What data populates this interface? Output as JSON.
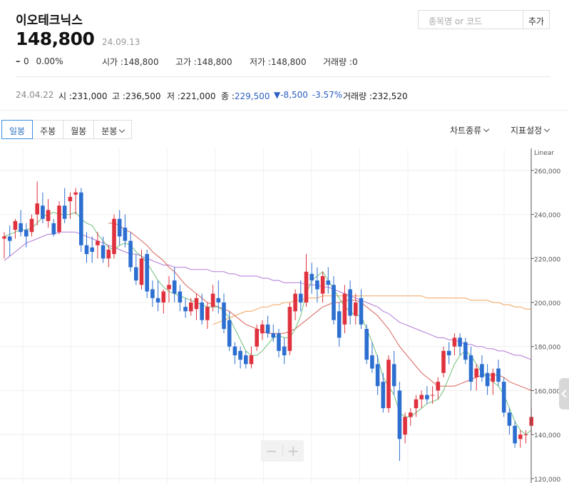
{
  "header": {
    "stock_name": "이오테크닉스",
    "price": "148,800",
    "date": "24.09.13",
    "change_dash": "–",
    "change": "0",
    "change_pct": "0.00%",
    "open_label": "시가 :",
    "open_value": "148,800",
    "high_label": "고가 :",
    "high_value": "148,800",
    "low_label": "저가 :",
    "low_value": "148,800",
    "volume_label": "거래량 :",
    "volume_value": "0",
    "search_placeholder": "종목명 or 코드",
    "add_label": "추가"
  },
  "hover": {
    "date": "24.04.22",
    "open_label": "시 :",
    "open_value": "231,000",
    "high_label": "고 :",
    "high_value": "236,500",
    "low_label": "저 :",
    "low_value": "221,000",
    "close_label": "종 :",
    "close_value": "229,500",
    "change_value": "▼-8,500",
    "change_pct": "-3.57%",
    "volume_label": "거래량 :",
    "volume_value": "232,520"
  },
  "tabs": [
    {
      "label": "일봉",
      "active": true
    },
    {
      "label": "주봉",
      "active": false
    },
    {
      "label": "월봉",
      "active": false
    },
    {
      "label": "분봉",
      "active": false,
      "dropdown": true
    }
  ],
  "menus": {
    "chart_type": "차트종류",
    "indicator": "지표설정"
  },
  "zoom": {
    "minus": "−",
    "plus": "+"
  },
  "colors": {
    "up": "#e0323e",
    "down": "#2c6fd1",
    "ma5": "#6dc07a",
    "ma20": "#d9665e",
    "ma60": "#b27ad8",
    "ma120": "#f0a35a"
  },
  "chart_data": {
    "type": "candlestick",
    "scale_label": "Linear",
    "y_ticks": [
      120000,
      140000,
      160000,
      180000,
      200000,
      220000,
      240000,
      260000
    ],
    "y_tick_labels": [
      "120,000",
      "140,000",
      "160,000",
      "180,000",
      "200,000",
      "220,000",
      "240,000",
      "260,000"
    ],
    "ylim": [
      118000,
      270000
    ],
    "grid": true,
    "candles": [
      [
        229,
        232,
        220,
        230
      ],
      [
        230,
        235,
        221,
        228
      ],
      [
        233,
        238,
        229,
        237
      ],
      [
        236,
        242,
        230,
        232
      ],
      [
        233,
        236,
        225,
        230
      ],
      [
        232,
        240,
        230,
        238
      ],
      [
        240,
        255,
        235,
        245
      ],
      [
        244,
        250,
        236,
        238
      ],
      [
        237,
        247,
        234,
        242
      ],
      [
        236,
        238,
        230,
        231
      ],
      [
        232,
        246,
        231,
        244
      ],
      [
        244,
        252,
        236,
        238
      ],
      [
        246,
        250,
        238,
        248
      ],
      [
        249,
        252,
        240,
        250
      ],
      [
        250,
        252,
        223,
        226
      ],
      [
        226,
        232,
        218,
        222
      ],
      [
        225,
        230,
        218,
        223
      ],
      [
        226,
        232,
        220,
        228
      ],
      [
        226,
        230,
        218,
        220
      ],
      [
        220,
        226,
        216,
        224
      ],
      [
        222,
        240,
        220,
        238
      ],
      [
        238,
        242,
        226,
        230
      ],
      [
        234,
        240,
        225,
        228
      ],
      [
        228,
        232,
        214,
        216
      ],
      [
        216,
        222,
        208,
        210
      ],
      [
        208,
        224,
        206,
        220
      ],
      [
        222,
        224,
        202,
        205
      ],
      [
        206,
        210,
        198,
        202
      ],
      [
        202,
        210,
        196,
        200
      ],
      [
        200,
        206,
        195,
        205
      ],
      [
        206,
        212,
        200,
        208
      ],
      [
        210,
        216,
        200,
        204
      ],
      [
        205,
        208,
        196,
        200
      ],
      [
        198,
        202,
        193,
        196
      ],
      [
        196,
        202,
        194,
        200
      ],
      [
        197,
        204,
        192,
        202
      ],
      [
        200,
        204,
        190,
        192
      ],
      [
        192,
        200,
        188,
        198
      ],
      [
        198,
        208,
        196,
        204
      ],
      [
        202,
        210,
        195,
        200
      ],
      [
        200,
        204,
        186,
        188
      ],
      [
        192,
        196,
        178,
        180
      ],
      [
        180,
        182,
        172,
        176
      ],
      [
        178,
        180,
        170,
        174
      ],
      [
        176,
        178,
        170,
        172
      ],
      [
        172,
        180,
        170,
        176
      ],
      [
        180,
        190,
        178,
        188
      ],
      [
        186,
        192,
        183,
        190
      ],
      [
        190,
        194,
        184,
        186
      ],
      [
        186,
        190,
        182,
        184
      ],
      [
        186,
        188,
        175,
        178
      ],
      [
        180,
        184,
        172,
        176
      ],
      [
        178,
        200,
        176,
        198
      ],
      [
        196,
        206,
        192,
        204
      ],
      [
        204,
        210,
        196,
        200
      ],
      [
        200,
        222,
        198,
        214
      ],
      [
        213,
        218,
        204,
        210
      ],
      [
        210,
        216,
        200,
        206
      ],
      [
        204,
        214,
        200,
        212
      ],
      [
        210,
        216,
        204,
        208
      ],
      [
        208,
        212,
        190,
        192
      ],
      [
        196,
        200,
        180,
        184
      ],
      [
        190,
        208,
        186,
        204
      ],
      [
        206,
        210,
        190,
        194
      ],
      [
        194,
        204,
        190,
        200
      ],
      [
        202,
        206,
        188,
        190
      ],
      [
        188,
        190,
        172,
        174
      ],
      [
        176,
        182,
        168,
        170
      ],
      [
        172,
        176,
        158,
        162
      ],
      [
        164,
        168,
        150,
        152
      ],
      [
        152,
        176,
        150,
        174
      ],
      [
        172,
        178,
        158,
        162
      ],
      [
        160,
        164,
        128,
        138
      ],
      [
        140,
        150,
        136,
        148
      ],
      [
        148,
        152,
        144,
        150
      ],
      [
        152,
        158,
        148,
        156
      ],
      [
        156,
        160,
        152,
        158
      ],
      [
        158,
        162,
        154,
        156
      ],
      [
        158,
        162,
        154,
        158
      ],
      [
        160,
        166,
        156,
        164
      ],
      [
        168,
        180,
        166,
        178
      ],
      [
        178,
        182,
        172,
        176
      ],
      [
        180,
        186,
        176,
        184
      ],
      [
        184,
        186,
        176,
        180
      ],
      [
        182,
        184,
        172,
        174
      ],
      [
        176,
        180,
        160,
        164
      ],
      [
        166,
        172,
        160,
        170
      ],
      [
        172,
        176,
        164,
        166
      ],
      [
        168,
        172,
        158,
        162
      ],
      [
        164,
        170,
        158,
        168
      ],
      [
        170,
        174,
        162,
        164
      ],
      [
        164,
        166,
        148,
        150
      ],
      [
        150,
        152,
        140,
        144
      ],
      [
        144,
        146,
        134,
        136
      ],
      [
        138,
        142,
        134,
        140
      ],
      [
        140,
        142,
        136,
        140
      ],
      [
        144,
        152,
        140,
        148
      ]
    ],
    "ma5": [
      230,
      231,
      232,
      233,
      233,
      234,
      236,
      239,
      240,
      241,
      240,
      240,
      240,
      241,
      238,
      236,
      235,
      231,
      228,
      225,
      224,
      226,
      227,
      226,
      223,
      221,
      218,
      214,
      210,
      207,
      205,
      204,
      203,
      202,
      201,
      200,
      199,
      198,
      198,
      198,
      196,
      193,
      188,
      183,
      178,
      176,
      176,
      178,
      181,
      184,
      185,
      184,
      184,
      188,
      194,
      204,
      210,
      212,
      214,
      210,
      206,
      202,
      198,
      196,
      194,
      194,
      188,
      182,
      175,
      166,
      162,
      158,
      150,
      148,
      148,
      150,
      152,
      154,
      155,
      156,
      160,
      166,
      172,
      176,
      178,
      176,
      172,
      168,
      166,
      164,
      162,
      158,
      152,
      146,
      142,
      140,
      142
    ],
    "ma20": [
      null,
      null,
      null,
      null,
      null,
      null,
      null,
      null,
      null,
      null,
      null,
      null,
      null,
      null,
      null,
      null,
      null,
      null,
      null,
      236,
      236,
      235,
      233,
      232,
      230,
      228,
      226,
      223,
      221,
      219,
      216,
      214,
      211,
      208,
      206,
      204,
      202,
      200,
      199,
      198,
      197,
      196,
      194,
      192,
      190,
      189,
      188,
      187,
      186,
      186,
      186,
      186,
      187,
      188,
      190,
      192,
      194,
      196,
      198,
      199,
      200,
      200,
      201,
      201,
      201,
      200,
      198,
      196,
      194,
      191,
      188,
      184,
      180,
      177,
      174,
      171,
      168,
      166,
      164,
      162,
      162,
      162,
      162,
      163,
      164,
      165,
      166,
      167,
      167,
      167,
      167,
      166,
      164,
      163,
      162,
      161,
      160
    ],
    "ma60": [
      219,
      221,
      223,
      225,
      227,
      228,
      229,
      230,
      231,
      231,
      232,
      232,
      232,
      232,
      231,
      230,
      229,
      228,
      227,
      226,
      225,
      224,
      223,
      222,
      222,
      221,
      220,
      219,
      218,
      217,
      217,
      216,
      216,
      216,
      215,
      215,
      215,
      215,
      214,
      214,
      214,
      213,
      213,
      212,
      212,
      212,
      212,
      211,
      211,
      210,
      210,
      209,
      209,
      209,
      209,
      208,
      208,
      208,
      207,
      207,
      206,
      205,
      204,
      203,
      202,
      201,
      200,
      199,
      198,
      196,
      195,
      193,
      191,
      190,
      189,
      188,
      187,
      186,
      185,
      184,
      184,
      183,
      183,
      182,
      181,
      181,
      180,
      180,
      179,
      179,
      178,
      178,
      177,
      176,
      176,
      175,
      174
    ],
    "ma120": [
      null,
      null,
      null,
      null,
      null,
      null,
      null,
      null,
      null,
      null,
      null,
      null,
      null,
      null,
      null,
      null,
      null,
      null,
      null,
      null,
      null,
      null,
      null,
      null,
      null,
      null,
      null,
      null,
      null,
      null,
      null,
      null,
      null,
      null,
      null,
      null,
      null,
      null,
      190,
      191,
      192,
      193,
      194,
      195,
      196,
      196,
      197,
      198,
      198,
      199,
      199,
      200,
      200,
      201,
      201,
      202,
      202,
      202,
      203,
      203,
      203,
      203,
      203,
      203,
      203,
      203,
      203,
      203,
      203,
      203,
      203,
      203,
      203,
      203,
      203,
      203,
      203,
      202,
      202,
      202,
      202,
      202,
      202,
      202,
      202,
      201,
      201,
      201,
      201,
      200,
      200,
      199,
      199,
      198,
      198,
      197,
      197
    ]
  }
}
